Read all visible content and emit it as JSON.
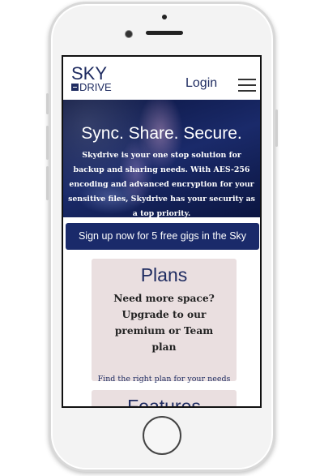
{
  "header": {
    "logo_top": "SKY",
    "logo_bottom": "DRIVE",
    "login_label": "Login"
  },
  "hero": {
    "title": "Sync. Share. Secure.",
    "text": "Skydrive is your one stop solution for backup and sharing needs. With AES-256 encoding and advanced encryption for your sensitive files, Skydrive has your security as a top priority."
  },
  "signup_label": "Sign up now for 5 free gigs in the Sky",
  "plans": {
    "title": "Plans",
    "description": "Need more space? Upgrade to our premium or Team plan",
    "link": "Find the right plan for your needs"
  },
  "features": {
    "title": "Features"
  },
  "colors": {
    "brand": "#1f2c61",
    "card_bg": "#eadfe0",
    "button_bg": "#1a2a6a"
  },
  "icons": {
    "menu": "hamburger-menu-icon"
  }
}
